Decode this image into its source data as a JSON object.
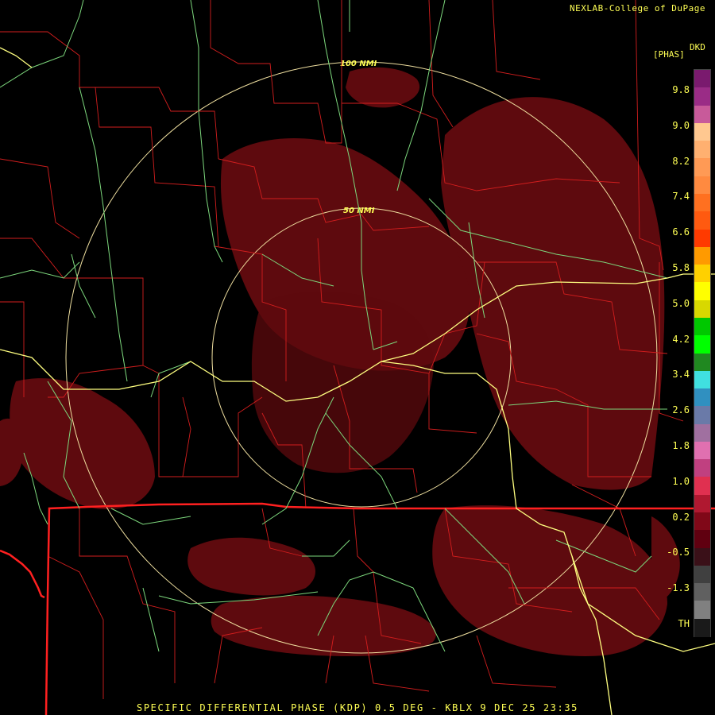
{
  "header": {
    "credit": "NEXLAB-College of DuPage"
  },
  "legend": {
    "product_code": "DKD",
    "units": "[PHAS]",
    "ticks": [
      "9.8",
      "9.0",
      "8.2",
      "7.4",
      "6.6",
      "5.8",
      "5.0",
      "4.2",
      "3.4",
      "2.6",
      "1.8",
      "1.0",
      "0.2",
      "-0.5",
      "-1.3",
      "TH"
    ],
    "colors": [
      "#7a1a6e",
      "#9a2c86",
      "#c85a9a",
      "#ffc890",
      "#ffb070",
      "#ff9a55",
      "#ff8a40",
      "#ff7020",
      "#ff5a10",
      "#ff3a00",
      "#ff9a00",
      "#ffd000",
      "#ffff00",
      "#d8d800",
      "#00c800",
      "#00ff00",
      "#208820",
      "#40e0e0",
      "#3090c0",
      "#6a7aa8",
      "#a070a0",
      "#e070b0",
      "#c04080",
      "#e03050",
      "#b01830",
      "#800818",
      "#600010",
      "#3a1018",
      "#404040",
      "#606060",
      "#808080",
      "#1a1a1a"
    ]
  },
  "rings": [
    {
      "label": "100 NMI",
      "range_nmi": 100
    },
    {
      "label": "50 NMI",
      "range_nmi": 50
    }
  ],
  "footer": {
    "caption": "SPECIFIC DIFFERENTIAL PHASE (KDP) 0.5 DEG - KBLX 9 DEC 25 23:35"
  },
  "colors": {
    "echo": "#5e0a0e",
    "county": "#d21e1e",
    "state": "#ff2020",
    "highway": "#7dd87d",
    "interstate": "#ffff80",
    "ring": "#f0e0a0",
    "text": "#ffff55"
  }
}
